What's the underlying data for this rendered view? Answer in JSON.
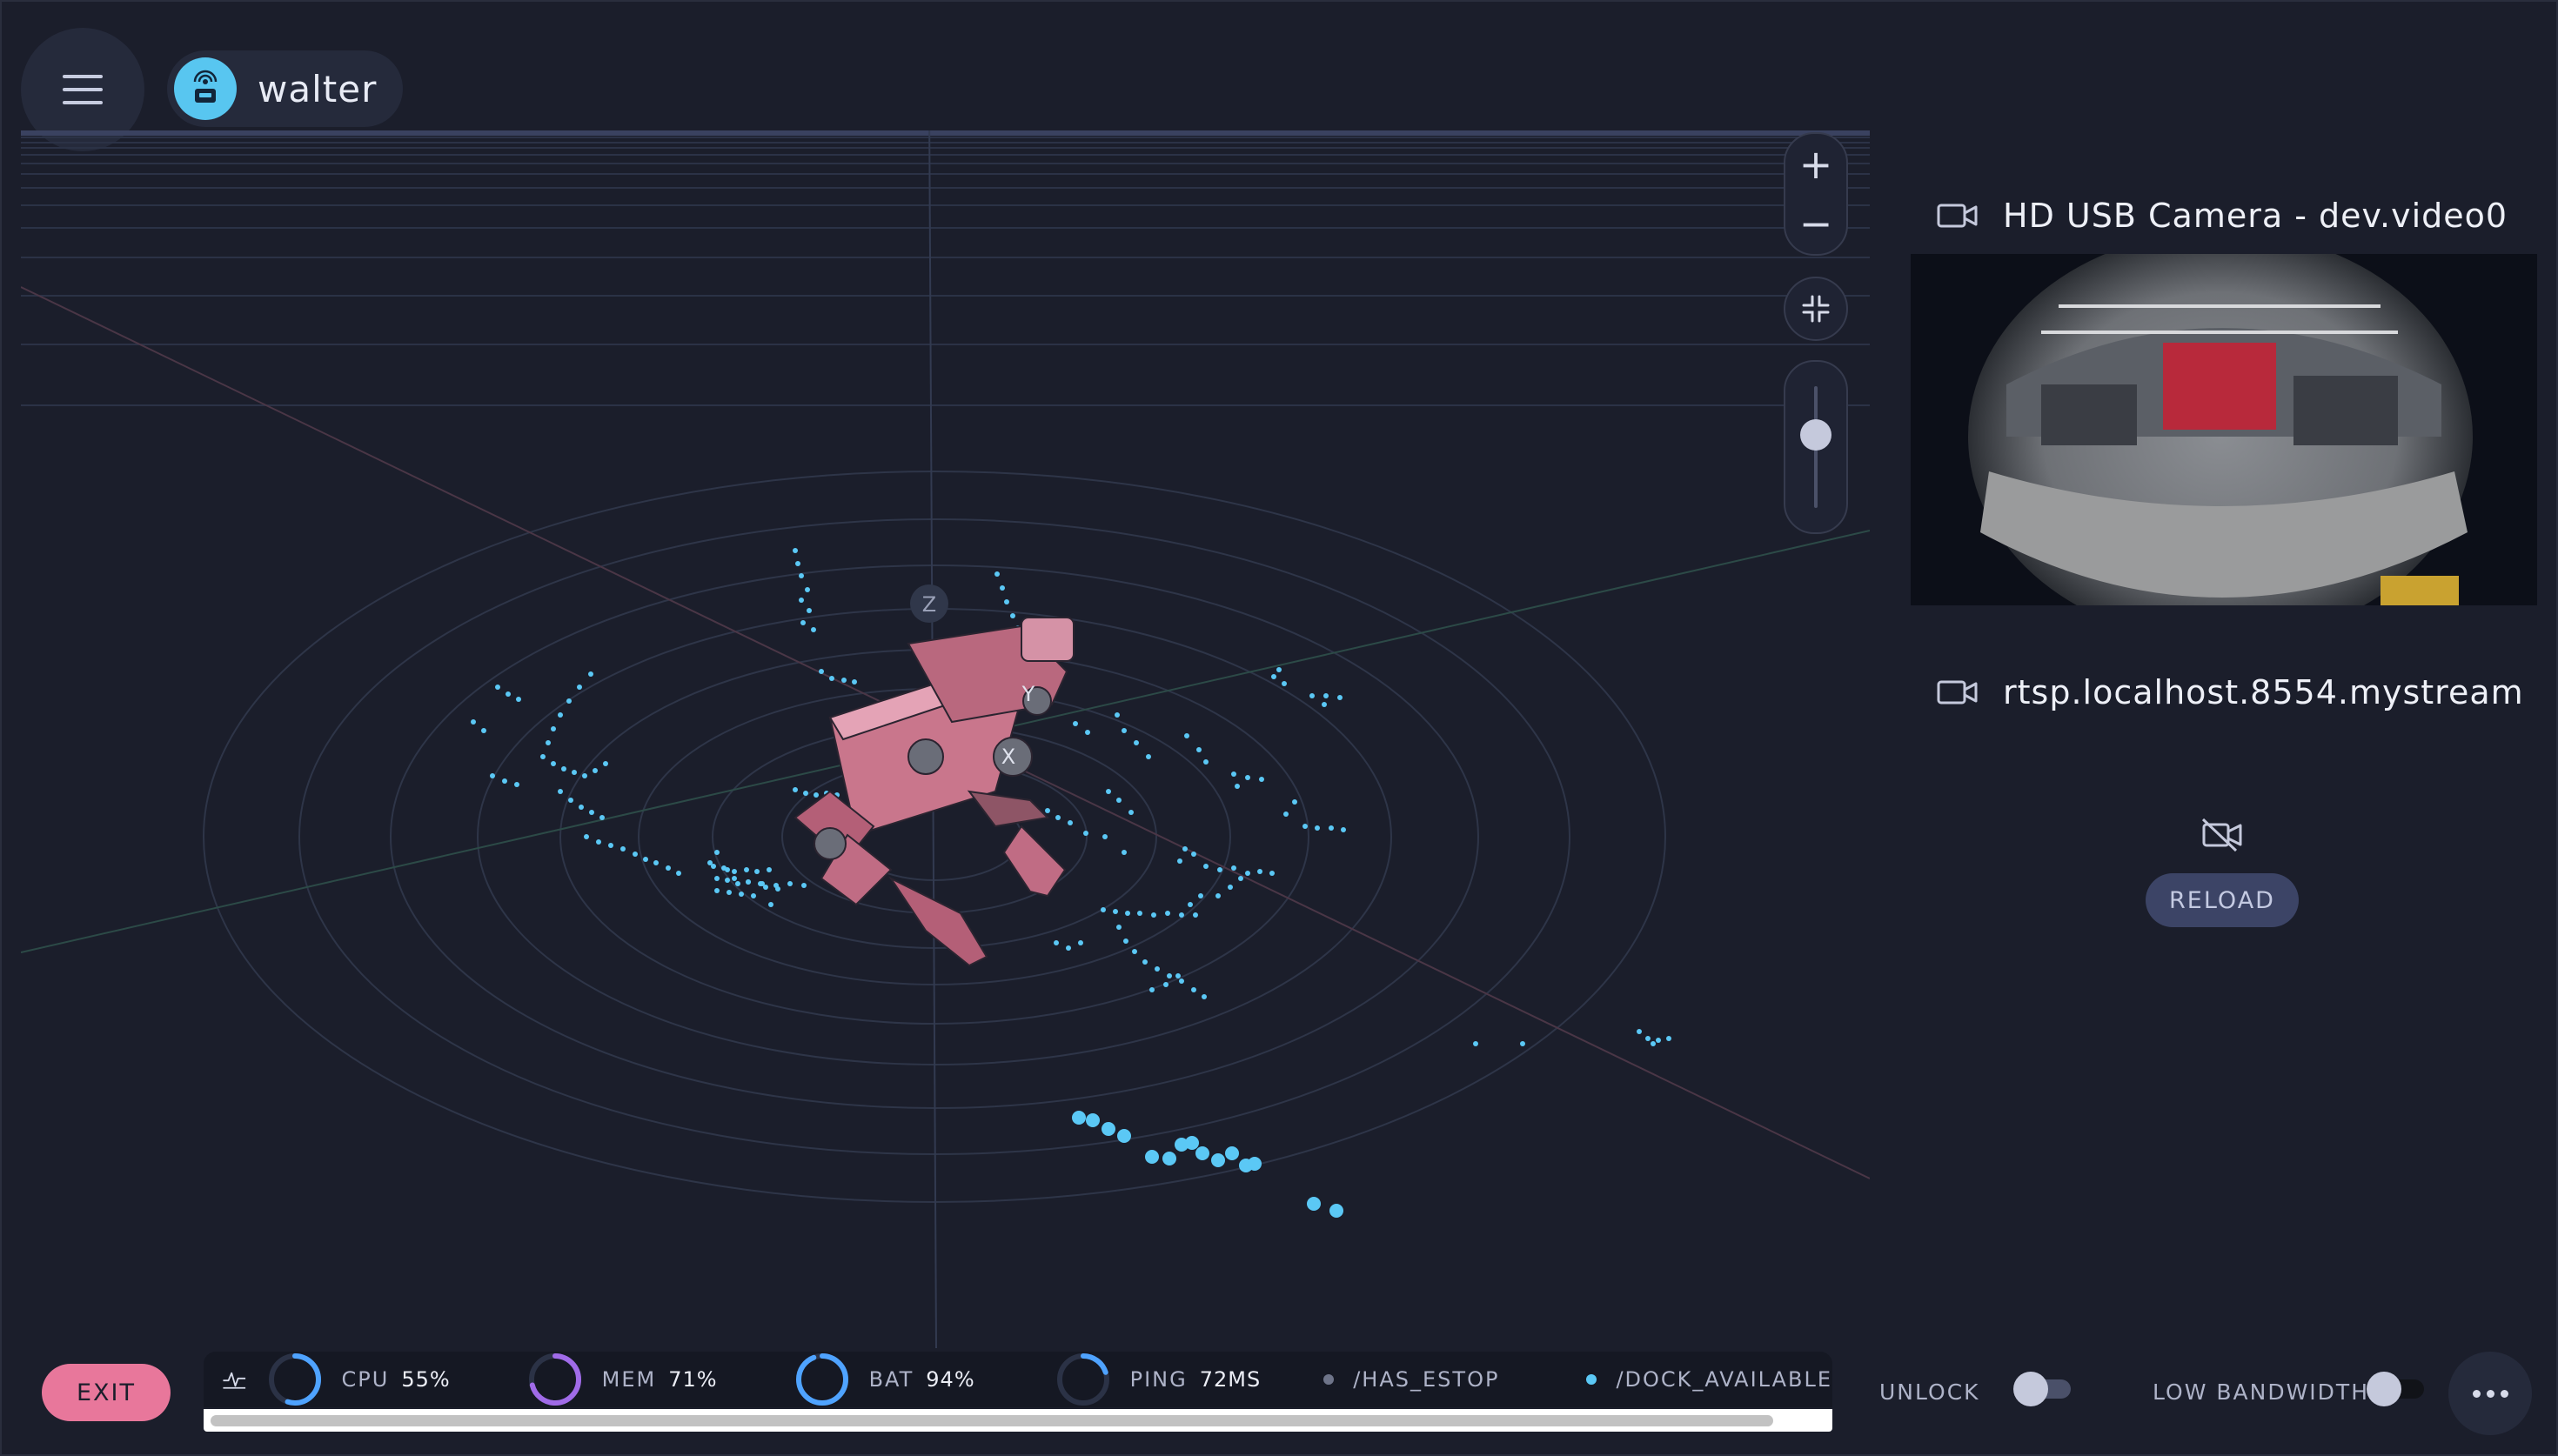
{
  "header": {
    "menu_icon": "hamburger-icon",
    "robot_icon": "robot-broadcast-icon",
    "robot_name": "walter"
  },
  "viewport": {
    "axis_labels": [
      "Z",
      "Y",
      "X"
    ],
    "controls": {
      "zoom_in_label": "+",
      "zoom_out_label": "−",
      "fit_icon": "collapse-arrows-icon",
      "slider_value": 0.6
    }
  },
  "cameras": [
    {
      "icon": "video-camera-icon",
      "title": "HD USB Camera - dev.video0",
      "state": "streaming"
    },
    {
      "icon": "video-camera-icon",
      "title": "rtsp.localhost.8554.mystream",
      "state": "offline",
      "offline_icon": "video-off-icon",
      "reload_label": "RELOAD"
    }
  ],
  "bottom_bar": {
    "exit_label": "EXIT",
    "activity_icon": "pulse-icon",
    "metrics": [
      {
        "label": "CPU",
        "value": "55%",
        "fraction": 0.55,
        "color": "#4fa3ff"
      },
      {
        "label": "MEM",
        "value": "71%",
        "fraction": 0.71,
        "color": "#a06be8"
      },
      {
        "label": "BAT",
        "value": "94%",
        "fraction": 0.94,
        "color": "#4fa3ff"
      },
      {
        "label": "PING",
        "value": "72MS",
        "fraction": 0.2,
        "color": "#4fa3ff"
      }
    ],
    "topics": [
      {
        "label": "/HAS_ESTOP",
        "color": "#6e7489"
      },
      {
        "label": "/DOCK_AVAILABLE",
        "color": "#5bc8f5"
      }
    ],
    "unlock_label": "UNLOCK",
    "low_bandwidth_label": "LOW BANDWIDTH",
    "more_icon": "more-horizontal-icon"
  },
  "colors": {
    "background": "#1b1e2b",
    "accent_pink": "#e8779b",
    "point_cloud": "#5bc8f5",
    "robot_body": "#c9768c"
  }
}
